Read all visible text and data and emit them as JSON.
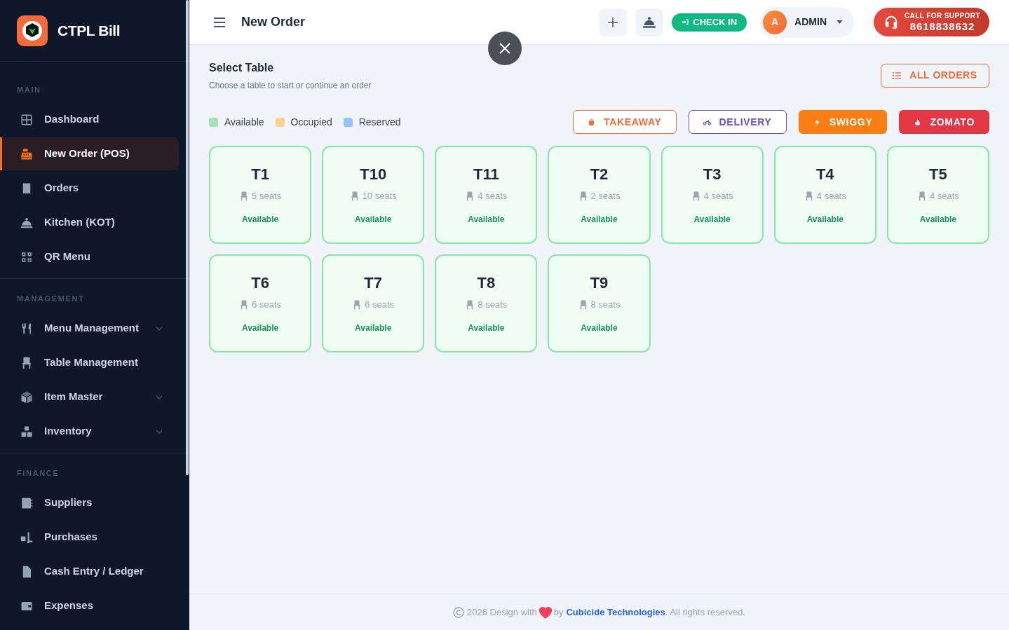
{
  "sidebar": {
    "brand": "CTPL Bill",
    "sections": [
      {
        "title": "MAIN",
        "items": [
          {
            "label": "Dashboard",
            "selected": false
          },
          {
            "label": "New Order (POS)",
            "selected": true
          },
          {
            "label": "Orders",
            "selected": false
          },
          {
            "label": "Kitchen (KOT)",
            "selected": false
          },
          {
            "label": "QR Menu",
            "selected": false
          }
        ]
      },
      {
        "title": "MANAGEMENT",
        "items": [
          {
            "label": "Menu Management",
            "selected": false,
            "submenu": true
          },
          {
            "label": "Table Management",
            "selected": false,
            "submenu": false
          },
          {
            "label": "Item Master",
            "selected": false,
            "submenu": true
          },
          {
            "label": "Inventory",
            "selected": false,
            "submenu": true
          }
        ]
      },
      {
        "title": "FINANCE",
        "items": [
          {
            "label": "Suppliers",
            "selected": false
          },
          {
            "label": "Purchases",
            "selected": false
          },
          {
            "label": "Cash Entry / Ledger",
            "selected": false
          },
          {
            "label": "Expenses",
            "selected": false
          }
        ]
      }
    ]
  },
  "header": {
    "title": "New Order",
    "check_in": "CHECK IN",
    "user": {
      "initial": "A",
      "name": "ADMIN"
    },
    "support": {
      "label": "CALL FOR SUPPORT",
      "phone": "8618838632"
    }
  },
  "page": {
    "title": "Select Table",
    "subtitle": "Choose a table to start or continue an order",
    "all_orders": "ALL ORDERS"
  },
  "legend": [
    {
      "label": "Available",
      "color": "#a7e3b5"
    },
    {
      "label": "Occupied",
      "color": "#fdd38b"
    },
    {
      "label": "Reserved",
      "color": "#93c5fd"
    }
  ],
  "order_types": [
    {
      "label": "TAKEAWAY",
      "kind": "outline",
      "color": "#f26b3a"
    },
    {
      "label": "DELIVERY",
      "kind": "outline",
      "color": "#6d4fc2"
    },
    {
      "label": "SWIGGY",
      "kind": "filled",
      "color": "#fb7e14"
    },
    {
      "label": "ZOMATO",
      "kind": "filled",
      "color": "#e23744"
    }
  ],
  "tables": [
    {
      "name": "T1",
      "seats": "5 seats",
      "kind": "available",
      "status": "Available"
    },
    {
      "name": "T10",
      "seats": "10 seats",
      "kind": "available",
      "status": "Available"
    },
    {
      "name": "T11",
      "seats": "4 seats",
      "kind": "available",
      "status": "Available"
    },
    {
      "name": "T2",
      "seats": "2 seats",
      "kind": "available",
      "status": "Available"
    },
    {
      "name": "T3",
      "seats": "4 seats",
      "kind": "available",
      "status": "Available"
    },
    {
      "name": "T4",
      "seats": "4 seats",
      "kind": "available",
      "status": "Available"
    },
    {
      "name": "T5",
      "seats": "4 seats",
      "kind": "available",
      "status": "Available"
    },
    {
      "name": "T6",
      "seats": "6 seats",
      "kind": "available",
      "status": "Available"
    },
    {
      "name": "T7",
      "seats": "6 seats",
      "kind": "available",
      "status": "Available"
    },
    {
      "name": "T8",
      "seats": "8 seats",
      "kind": "available",
      "status": "Available"
    },
    {
      "name": "T9",
      "seats": "8 seats",
      "kind": "available",
      "status": "Available"
    }
  ],
  "footer": {
    "text": "2026 Design with",
    "by": "by",
    "link": "Cubicide Technologies",
    "suffix": ". All rights reserved."
  }
}
